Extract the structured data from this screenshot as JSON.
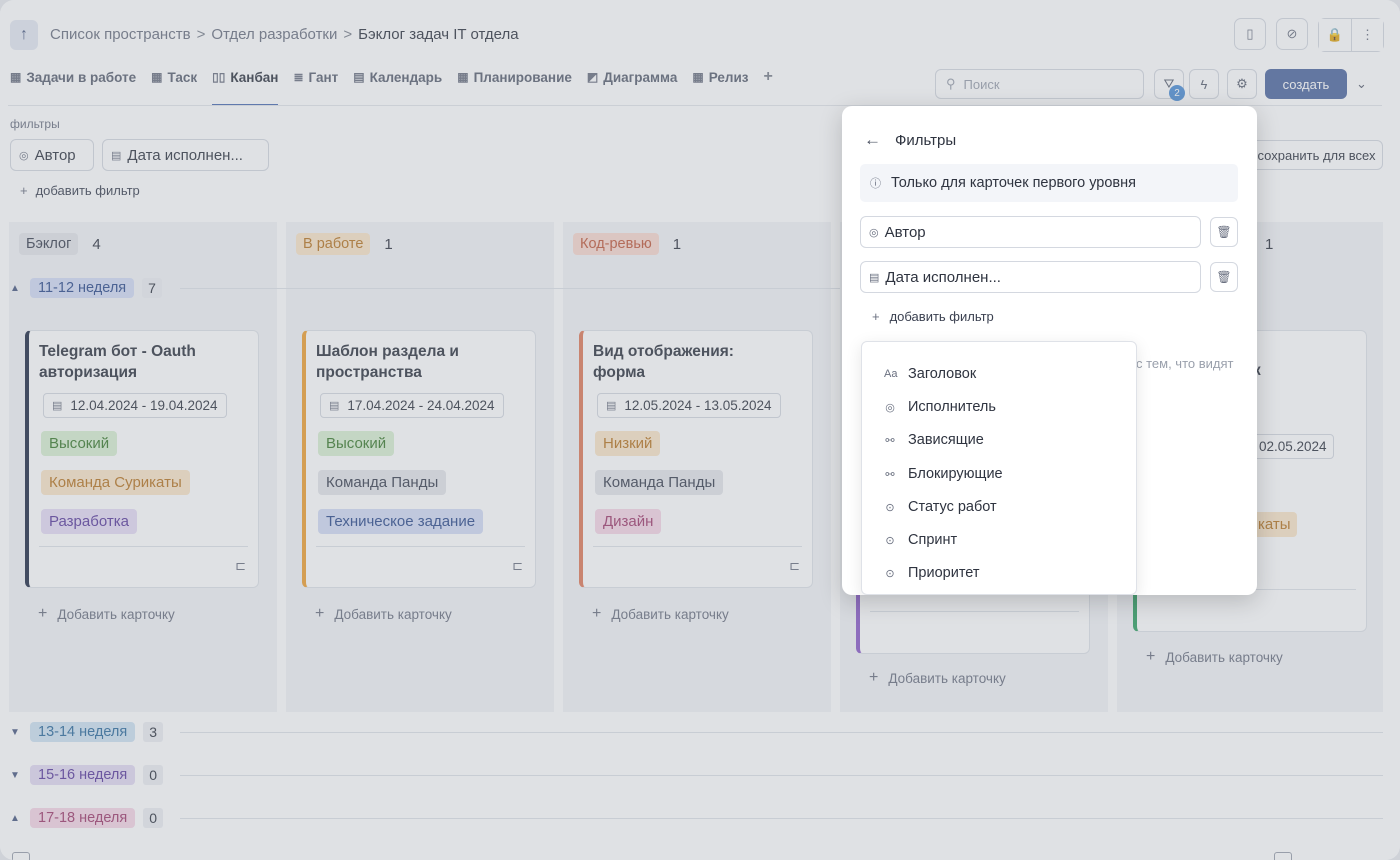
{
  "breadcrumb": {
    "item1": "Список пространств",
    "sep": ">",
    "item2": "Отдел разработки",
    "current": "Бэклог задач IT отдела"
  },
  "icons": {
    "back": "↑",
    "bookmark": "▯",
    "link": "⊘",
    "lock": "🔒",
    "more": "⋮",
    "search": "⚲",
    "filter": "⛛",
    "bolt": "ϟ",
    "gear": "⚙",
    "chevron": "⌄",
    "user": "◎",
    "calendar": "▤",
    "info": "ⓘ",
    "trash": "🗑",
    "plus": "+",
    "arrow_left": "←",
    "subtask": "⊏",
    "tri_up": "▲",
    "tri_down": "▼"
  },
  "tabs": [
    {
      "icon": "▦",
      "label": "Задачи в работе"
    },
    {
      "icon": "▦",
      "label": "Таск"
    },
    {
      "icon": "▯▯",
      "label": "Канбан"
    },
    {
      "icon": "≣",
      "label": "Гант"
    },
    {
      "icon": "▤",
      "label": "Календарь"
    },
    {
      "icon": "▦",
      "label": "Планирование"
    },
    {
      "icon": "◩",
      "label": "Диаграмма"
    },
    {
      "icon": "▦",
      "label": "Релиз"
    }
  ],
  "search": {
    "placeholder": "Поиск"
  },
  "filter_badge": "2",
  "create_label": "создать",
  "filters": {
    "label": "фильтры",
    "chips": [
      "Автор",
      "Дата исполнен..."
    ],
    "add_label": "добавить фильтр",
    "save_all": "сохранить для всех"
  },
  "columns": [
    {
      "name": "Бэклог",
      "count": "4",
      "pill_bg": "#e4e6ea",
      "pill_fg": "#3a4050"
    },
    {
      "name": "В работе",
      "count": "1",
      "pill_bg": "#fbe6c8",
      "pill_fg": "#b87420"
    },
    {
      "name": "Код-ревью",
      "count": "1",
      "pill_bg": "#fad9cf",
      "pill_fg": "#c0583a"
    },
    {
      "name": "",
      "count": "",
      "pill_bg": "",
      "pill_fg": ""
    },
    {
      "name": "",
      "count": "1",
      "pill_bg": "",
      "pill_fg": ""
    }
  ],
  "groups": [
    {
      "label": "11-12 неделя",
      "count": "7",
      "bg": "#d3dcf5",
      "fg": "#2c4a8c"
    },
    {
      "label": "13-14 неделя",
      "count": "3",
      "bg": "#cfe3f3",
      "fg": "#2c6a9c"
    },
    {
      "label": "15-16 неделя",
      "count": "0",
      "bg": "#e3daf3",
      "fg": "#5a3a9c"
    },
    {
      "label": "17-18 неделя",
      "count": "0",
      "bg": "#f6d6e6",
      "fg": "#a03a6c"
    }
  ],
  "cards": [
    {
      "title_l1": "Telegram бот - Oauth",
      "title_l2": "авторизация",
      "date": "12.04.2024 - 19.04.2024",
      "accent": "#1f2a44",
      "tags": [
        {
          "label": "Высокий",
          "bg": "#d9efd2",
          "fg": "#3a7a2c"
        },
        {
          "label": "Команда Сурикаты",
          "bg": "#fbe6c8",
          "fg": "#b87420"
        },
        {
          "label": "Разработка",
          "bg": "#e6dcf5",
          "fg": "#5a3a9c"
        }
      ]
    },
    {
      "title_l1": "Шаблон раздела и",
      "title_l2": "пространства",
      "date": "17.04.2024 - 24.04.2024",
      "accent": "#f0a030",
      "tags": [
        {
          "label": "Высокий",
          "bg": "#d9efd2",
          "fg": "#3a7a2c"
        },
        {
          "label": "Команда Панды",
          "bg": "#e4e6ea",
          "fg": "#3a4050"
        },
        {
          "label": "Техническое задание",
          "bg": "#d3dcf5",
          "fg": "#2c4a8c"
        }
      ]
    },
    {
      "title_l1": "Вид отображения:",
      "title_l2": "форма",
      "date": "12.05.2024 - 13.05.2024",
      "accent": "#e07a5a",
      "tags": [
        {
          "label": "Низкий",
          "bg": "#fbe6c8",
          "fg": "#b87420"
        },
        {
          "label": "Команда Панды",
          "bg": "#e4e6ea",
          "fg": "#3a4050"
        },
        {
          "label": "Дизайн",
          "bg": "#f6d6e6",
          "fg": "#a03a6c"
        }
      ]
    }
  ],
  "partial_card": {
    "title_fragment": "к",
    "date_fragment": "02.05.2024",
    "tag_fragment": "каты"
  },
  "add_card_label": "Добавить карточку",
  "panel": {
    "title": "Фильтры",
    "note": "Только для карточек первого уровня",
    "fields": [
      "Автор",
      "Дата исполнен..."
    ],
    "add_label": "добавить фильтр",
    "hint": "с тем, что видят"
  },
  "dropdown": [
    {
      "icon": "Aa",
      "label": "Заголовок"
    },
    {
      "icon": "◎",
      "label": "Исполнитель"
    },
    {
      "icon": "⚯",
      "label": "Зависящие"
    },
    {
      "icon": "⚯",
      "label": "Блокирующие"
    },
    {
      "icon": "⊙",
      "label": "Статус работ"
    },
    {
      "icon": "⊙",
      "label": "Спринт"
    },
    {
      "icon": "⊙",
      "label": "Приоритет"
    }
  ]
}
